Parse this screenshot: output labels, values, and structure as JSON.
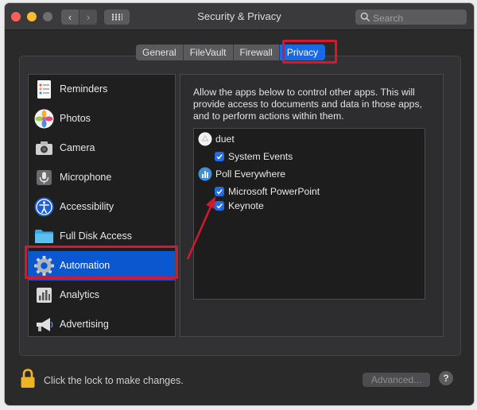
{
  "window": {
    "title": "Security & Privacy",
    "nav_back": "‹",
    "nav_forward": "›"
  },
  "search": {
    "placeholder": "Search"
  },
  "tabs": [
    {
      "label": "General",
      "selected": false
    },
    {
      "label": "FileVault",
      "selected": false
    },
    {
      "label": "Firewall",
      "selected": false
    },
    {
      "label": "Privacy",
      "selected": true
    }
  ],
  "sidebar": {
    "items": [
      {
        "label": "Reminders",
        "icon": "reminders-icon",
        "selected": false
      },
      {
        "label": "Photos",
        "icon": "photos-icon",
        "selected": false
      },
      {
        "label": "Camera",
        "icon": "camera-icon",
        "selected": false
      },
      {
        "label": "Microphone",
        "icon": "microphone-icon",
        "selected": false
      },
      {
        "label": "Accessibility",
        "icon": "accessibility-icon",
        "selected": false
      },
      {
        "label": "Full Disk Access",
        "icon": "folder-icon",
        "selected": false
      },
      {
        "label": "Automation",
        "icon": "gear-icon",
        "selected": true
      },
      {
        "label": "Analytics",
        "icon": "analytics-icon",
        "selected": false
      },
      {
        "label": "Advertising",
        "icon": "megaphone-icon",
        "selected": false
      }
    ]
  },
  "main": {
    "description": "Allow the apps below to control other apps. This will provide access to documents and data in those apps, and to perform actions within them.",
    "apps": [
      {
        "name": "duet",
        "icon": "duet-icon",
        "targets": [
          {
            "label": "System Events",
            "checked": true
          }
        ]
      },
      {
        "name": "Poll Everywhere",
        "icon": "poll-everywhere-icon",
        "targets": [
          {
            "label": "Microsoft PowerPoint",
            "checked": true
          },
          {
            "label": "Keynote",
            "checked": true
          }
        ]
      }
    ]
  },
  "footer": {
    "lock_text": "Click the lock to make changes.",
    "advanced_label": "Advanced...",
    "help_label": "?"
  },
  "colors": {
    "accent": "#1769e6",
    "highlight": "#d4192f",
    "window_bg": "#2a2a2b"
  }
}
